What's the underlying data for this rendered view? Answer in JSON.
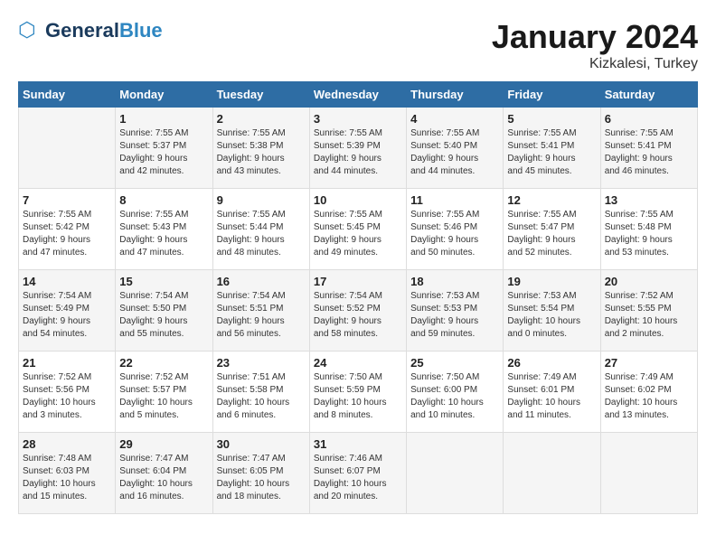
{
  "header": {
    "logo_general": "General",
    "logo_blue": "Blue",
    "main_title": "January 2024",
    "subtitle": "Kizkalesi, Turkey"
  },
  "days_of_week": [
    "Sunday",
    "Monday",
    "Tuesday",
    "Wednesday",
    "Thursday",
    "Friday",
    "Saturday"
  ],
  "weeks": [
    [
      {
        "day": "",
        "info": ""
      },
      {
        "day": "1",
        "info": "Sunrise: 7:55 AM\nSunset: 5:37 PM\nDaylight: 9 hours\nand 42 minutes."
      },
      {
        "day": "2",
        "info": "Sunrise: 7:55 AM\nSunset: 5:38 PM\nDaylight: 9 hours\nand 43 minutes."
      },
      {
        "day": "3",
        "info": "Sunrise: 7:55 AM\nSunset: 5:39 PM\nDaylight: 9 hours\nand 44 minutes."
      },
      {
        "day": "4",
        "info": "Sunrise: 7:55 AM\nSunset: 5:40 PM\nDaylight: 9 hours\nand 44 minutes."
      },
      {
        "day": "5",
        "info": "Sunrise: 7:55 AM\nSunset: 5:41 PM\nDaylight: 9 hours\nand 45 minutes."
      },
      {
        "day": "6",
        "info": "Sunrise: 7:55 AM\nSunset: 5:41 PM\nDaylight: 9 hours\nand 46 minutes."
      }
    ],
    [
      {
        "day": "7",
        "info": "Sunrise: 7:55 AM\nSunset: 5:42 PM\nDaylight: 9 hours\nand 47 minutes."
      },
      {
        "day": "8",
        "info": "Sunrise: 7:55 AM\nSunset: 5:43 PM\nDaylight: 9 hours\nand 47 minutes."
      },
      {
        "day": "9",
        "info": "Sunrise: 7:55 AM\nSunset: 5:44 PM\nDaylight: 9 hours\nand 48 minutes."
      },
      {
        "day": "10",
        "info": "Sunrise: 7:55 AM\nSunset: 5:45 PM\nDaylight: 9 hours\nand 49 minutes."
      },
      {
        "day": "11",
        "info": "Sunrise: 7:55 AM\nSunset: 5:46 PM\nDaylight: 9 hours\nand 50 minutes."
      },
      {
        "day": "12",
        "info": "Sunrise: 7:55 AM\nSunset: 5:47 PM\nDaylight: 9 hours\nand 52 minutes."
      },
      {
        "day": "13",
        "info": "Sunrise: 7:55 AM\nSunset: 5:48 PM\nDaylight: 9 hours\nand 53 minutes."
      }
    ],
    [
      {
        "day": "14",
        "info": "Sunrise: 7:54 AM\nSunset: 5:49 PM\nDaylight: 9 hours\nand 54 minutes."
      },
      {
        "day": "15",
        "info": "Sunrise: 7:54 AM\nSunset: 5:50 PM\nDaylight: 9 hours\nand 55 minutes."
      },
      {
        "day": "16",
        "info": "Sunrise: 7:54 AM\nSunset: 5:51 PM\nDaylight: 9 hours\nand 56 minutes."
      },
      {
        "day": "17",
        "info": "Sunrise: 7:54 AM\nSunset: 5:52 PM\nDaylight: 9 hours\nand 58 minutes."
      },
      {
        "day": "18",
        "info": "Sunrise: 7:53 AM\nSunset: 5:53 PM\nDaylight: 9 hours\nand 59 minutes."
      },
      {
        "day": "19",
        "info": "Sunrise: 7:53 AM\nSunset: 5:54 PM\nDaylight: 10 hours\nand 0 minutes."
      },
      {
        "day": "20",
        "info": "Sunrise: 7:52 AM\nSunset: 5:55 PM\nDaylight: 10 hours\nand 2 minutes."
      }
    ],
    [
      {
        "day": "21",
        "info": "Sunrise: 7:52 AM\nSunset: 5:56 PM\nDaylight: 10 hours\nand 3 minutes."
      },
      {
        "day": "22",
        "info": "Sunrise: 7:52 AM\nSunset: 5:57 PM\nDaylight: 10 hours\nand 5 minutes."
      },
      {
        "day": "23",
        "info": "Sunrise: 7:51 AM\nSunset: 5:58 PM\nDaylight: 10 hours\nand 6 minutes."
      },
      {
        "day": "24",
        "info": "Sunrise: 7:50 AM\nSunset: 5:59 PM\nDaylight: 10 hours\nand 8 minutes."
      },
      {
        "day": "25",
        "info": "Sunrise: 7:50 AM\nSunset: 6:00 PM\nDaylight: 10 hours\nand 10 minutes."
      },
      {
        "day": "26",
        "info": "Sunrise: 7:49 AM\nSunset: 6:01 PM\nDaylight: 10 hours\nand 11 minutes."
      },
      {
        "day": "27",
        "info": "Sunrise: 7:49 AM\nSunset: 6:02 PM\nDaylight: 10 hours\nand 13 minutes."
      }
    ],
    [
      {
        "day": "28",
        "info": "Sunrise: 7:48 AM\nSunset: 6:03 PM\nDaylight: 10 hours\nand 15 minutes."
      },
      {
        "day": "29",
        "info": "Sunrise: 7:47 AM\nSunset: 6:04 PM\nDaylight: 10 hours\nand 16 minutes."
      },
      {
        "day": "30",
        "info": "Sunrise: 7:47 AM\nSunset: 6:05 PM\nDaylight: 10 hours\nand 18 minutes."
      },
      {
        "day": "31",
        "info": "Sunrise: 7:46 AM\nSunset: 6:07 PM\nDaylight: 10 hours\nand 20 minutes."
      },
      {
        "day": "",
        "info": ""
      },
      {
        "day": "",
        "info": ""
      },
      {
        "day": "",
        "info": ""
      }
    ]
  ]
}
